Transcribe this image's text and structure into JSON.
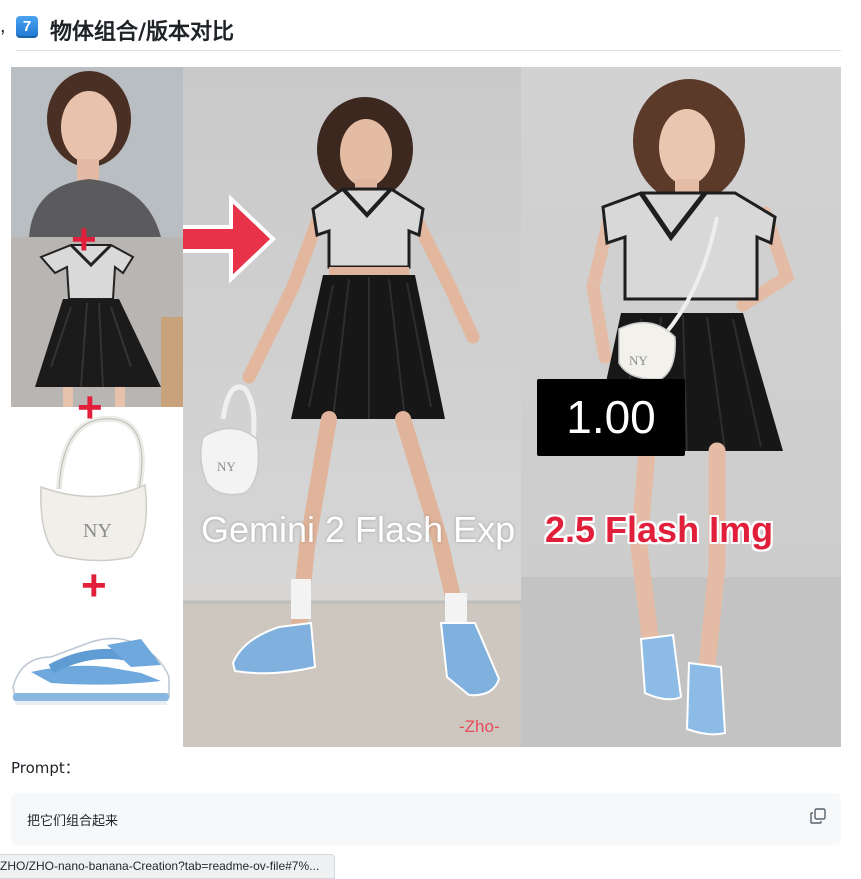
{
  "heading": {
    "keycap": "7",
    "title": "物体组合/版本对比",
    "anchor_icon": "link-icon"
  },
  "figure": {
    "mid_label": "Gemini 2 Flash Exp",
    "right_label": "2.5 Flash Img",
    "watermark": "-Zho-",
    "score": "1.00",
    "plus_sign": "+",
    "brand_on_bag": "NY",
    "accent_color": "#e21f3a"
  },
  "prompt": {
    "label": "Prompt：",
    "text": "把它们组合起来",
    "copy_icon": "copy-icon"
  },
  "statusbar": {
    "url": "ZHO/ZHO-nano-banana-Creation?tab=readme-ov-file#7%..."
  }
}
